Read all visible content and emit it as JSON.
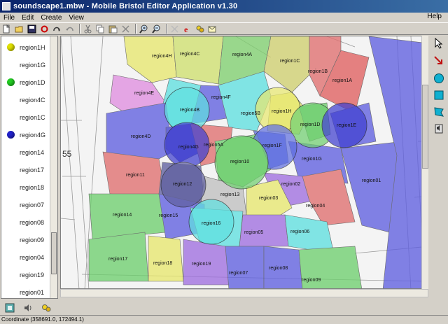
{
  "window": {
    "title": "soundscape1.mbw - Mobile Bristol Editor Application v1.30"
  },
  "menu": {
    "file": "File",
    "edit": "Edit",
    "create": "Create",
    "view": "View",
    "help": "Help"
  },
  "toolbar": {
    "icons": [
      "new-file-icon",
      "open-folder-icon",
      "save-icon",
      "undo-icon",
      "redo-icon",
      "refresh-icon",
      "cut-icon",
      "copy-icon",
      "paste-icon",
      "delete-icon",
      "zoom-in-icon",
      "zoom-out-icon",
      "disabled-x-icon",
      "e-icon",
      "sound-region-icon",
      "message-icon"
    ]
  },
  "sidebar": {
    "items": [
      {
        "label": "region1H",
        "dot": "#e0e000"
      },
      {
        "label": "region1G",
        "dot": ""
      },
      {
        "label": "region1D",
        "dot": "#22cc22"
      },
      {
        "label": "region4C",
        "dot": ""
      },
      {
        "label": "region1C",
        "dot": ""
      },
      {
        "label": "region4G",
        "dot": "#2222cc"
      },
      {
        "label": "region14",
        "dot": ""
      },
      {
        "label": "region17",
        "dot": ""
      },
      {
        "label": "region18",
        "dot": ""
      },
      {
        "label": "region07",
        "dot": ""
      },
      {
        "label": "region08",
        "dot": ""
      },
      {
        "label": "region09",
        "dot": ""
      },
      {
        "label": "region04",
        "dot": ""
      },
      {
        "label": "region19",
        "dot": ""
      },
      {
        "label": "region01",
        "dot": ""
      }
    ]
  },
  "map": {
    "side_number": "55",
    "regions": [
      {
        "name": "region4H",
        "color": "#e8e870"
      },
      {
        "name": "region4C",
        "color": "#d0e070"
      },
      {
        "name": "region4A",
        "color": "#80d070"
      },
      {
        "name": "region1C",
        "color": "#d0d070"
      },
      {
        "name": "region1B",
        "color": "#e07070"
      },
      {
        "name": "region1A",
        "color": "#e06060"
      },
      {
        "name": "region4E",
        "color": "#e090e0"
      },
      {
        "name": "region4F",
        "color": "#6060e0"
      },
      {
        "name": "region4B",
        "color": "#60e0e0"
      },
      {
        "name": "region5B",
        "color": "#60e0e0"
      },
      {
        "name": "region1H",
        "color": "#e8e870"
      },
      {
        "name": "region1D",
        "color": "#70d070"
      },
      {
        "name": "region1E",
        "color": "#6060e0"
      },
      {
        "name": "region4D",
        "color": "#6060e0"
      },
      {
        "name": "region4G",
        "color": "#4040d0"
      },
      {
        "name": "region5A",
        "color": "#e07070"
      },
      {
        "name": "region1F",
        "color": "#6070e0"
      },
      {
        "name": "region1G",
        "color": "#6060e0"
      },
      {
        "name": "region10",
        "color": "#70d070"
      },
      {
        "name": "region11",
        "color": "#e07070"
      },
      {
        "name": "region12",
        "color": "#6060a0"
      },
      {
        "name": "region13",
        "color": "#c0c0c0"
      },
      {
        "name": "region02",
        "color": "#a070e0"
      },
      {
        "name": "region01",
        "color": "#6060e0"
      },
      {
        "name": "region03",
        "color": "#e8e870"
      },
      {
        "name": "region04",
        "color": "#e07070"
      },
      {
        "name": "region14",
        "color": "#70d070"
      },
      {
        "name": "region15",
        "color": "#6060e0"
      },
      {
        "name": "region16",
        "color": "#60e0e0"
      },
      {
        "name": "region05",
        "color": "#a070e0"
      },
      {
        "name": "region06",
        "color": "#60e0e0"
      },
      {
        "name": "region17",
        "color": "#70d070"
      },
      {
        "name": "region18",
        "color": "#e8e870"
      },
      {
        "name": "region19",
        "color": "#a070e0"
      },
      {
        "name": "region07",
        "color": "#6060e0"
      },
      {
        "name": "region08",
        "color": "#6060e0"
      },
      {
        "name": "region09",
        "color": "#70d070"
      }
    ]
  },
  "palette": {
    "icons": [
      "pointer-icon",
      "move-arrow-icon",
      "circle-region-icon",
      "rectangle-region-icon",
      "polygon-region-icon",
      "sound-properties-icon"
    ]
  },
  "status": {
    "coordinate": "Coordinate (358691.0, 172494.1)"
  },
  "colors": {
    "titlebar_start": "#0a246a",
    "titlebar_end": "#3a6ea5",
    "chrome": "#d4d0c8"
  }
}
